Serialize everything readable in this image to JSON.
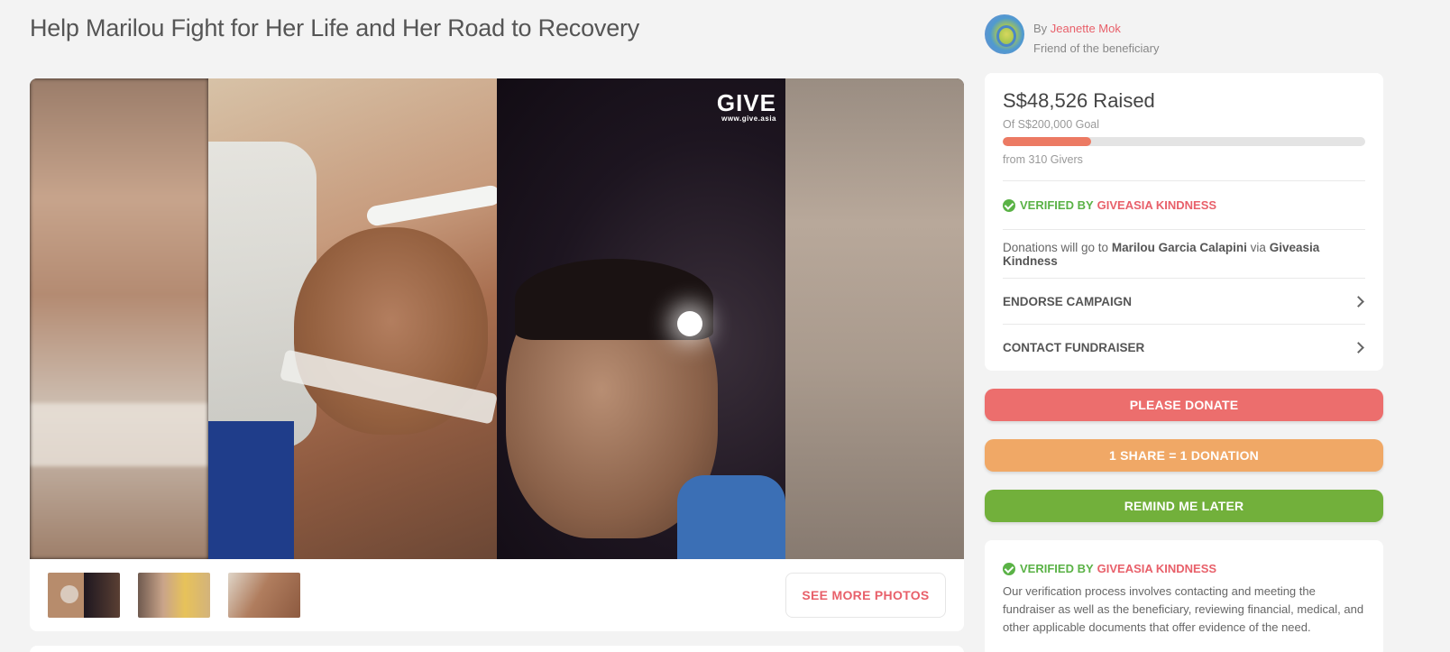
{
  "page": {
    "title": "Help Marilou Fight for Her Life and Her Road to Recovery"
  },
  "fundraiser": {
    "by_label": "By",
    "name": "Jeanette Mok",
    "relation": "Friend of the beneficiary"
  },
  "gallery": {
    "watermark_main": "GIVE",
    "watermark_sub": "www.give.asia",
    "see_more_label": "SEE MORE PHOTOS",
    "thumbnail_count": 3
  },
  "progress": {
    "raised_text": "S$48,526 Raised",
    "goal_text": "Of S$200,000 Goal",
    "givers_text": "from 310 Givers",
    "fraction": 0.243,
    "bar_color": "#ec7a63"
  },
  "verification": {
    "prefix": "VERIFIED BY",
    "org": "GIVEASIA KINDNESS",
    "description": "Our verification process involves contacting and meeting the fundraiser as well as the beneficiary, reviewing financial, medical, and other applicable documents that offer evidence of the need."
  },
  "donations": {
    "prefix": "Donations will go to",
    "beneficiary": "Marilou Garcia Calapini",
    "via": "via",
    "org": "Giveasia Kindness"
  },
  "menu": {
    "endorse": "ENDORSE CAMPAIGN",
    "contact": "CONTACT FUNDRAISER"
  },
  "buttons": {
    "donate": "PLEASE DONATE",
    "share": "1 SHARE = 1 DONATION",
    "remind": "REMIND ME LATER"
  },
  "colors": {
    "accent_red": "#e8606a",
    "verified_green": "#5ab246",
    "donate": "#ec6e6d",
    "share": "#f0a866",
    "remind": "#72b03b"
  }
}
